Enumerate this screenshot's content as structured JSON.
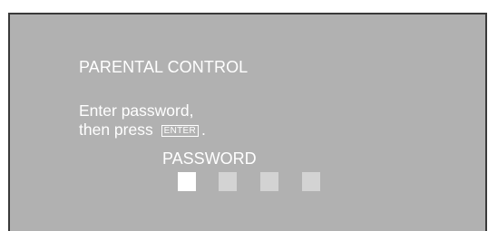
{
  "screen": {
    "title": "PARENTAL CONTROL",
    "message_line1": "Enter password,",
    "message_line2_prefix": "then press",
    "enter_key_label": "ENTER",
    "message_line2_suffix": ".",
    "password_label": "PASSWORD",
    "password_digits": [
      {
        "state": "active"
      },
      {
        "state": "empty"
      },
      {
        "state": "empty"
      },
      {
        "state": "empty"
      }
    ]
  },
  "colors": {
    "screen_background": "#b1b1b1",
    "text": "#ffffff",
    "active_box": "#ffffff",
    "empty_box": "#d3d3d3",
    "border": "#3a3a3a"
  }
}
